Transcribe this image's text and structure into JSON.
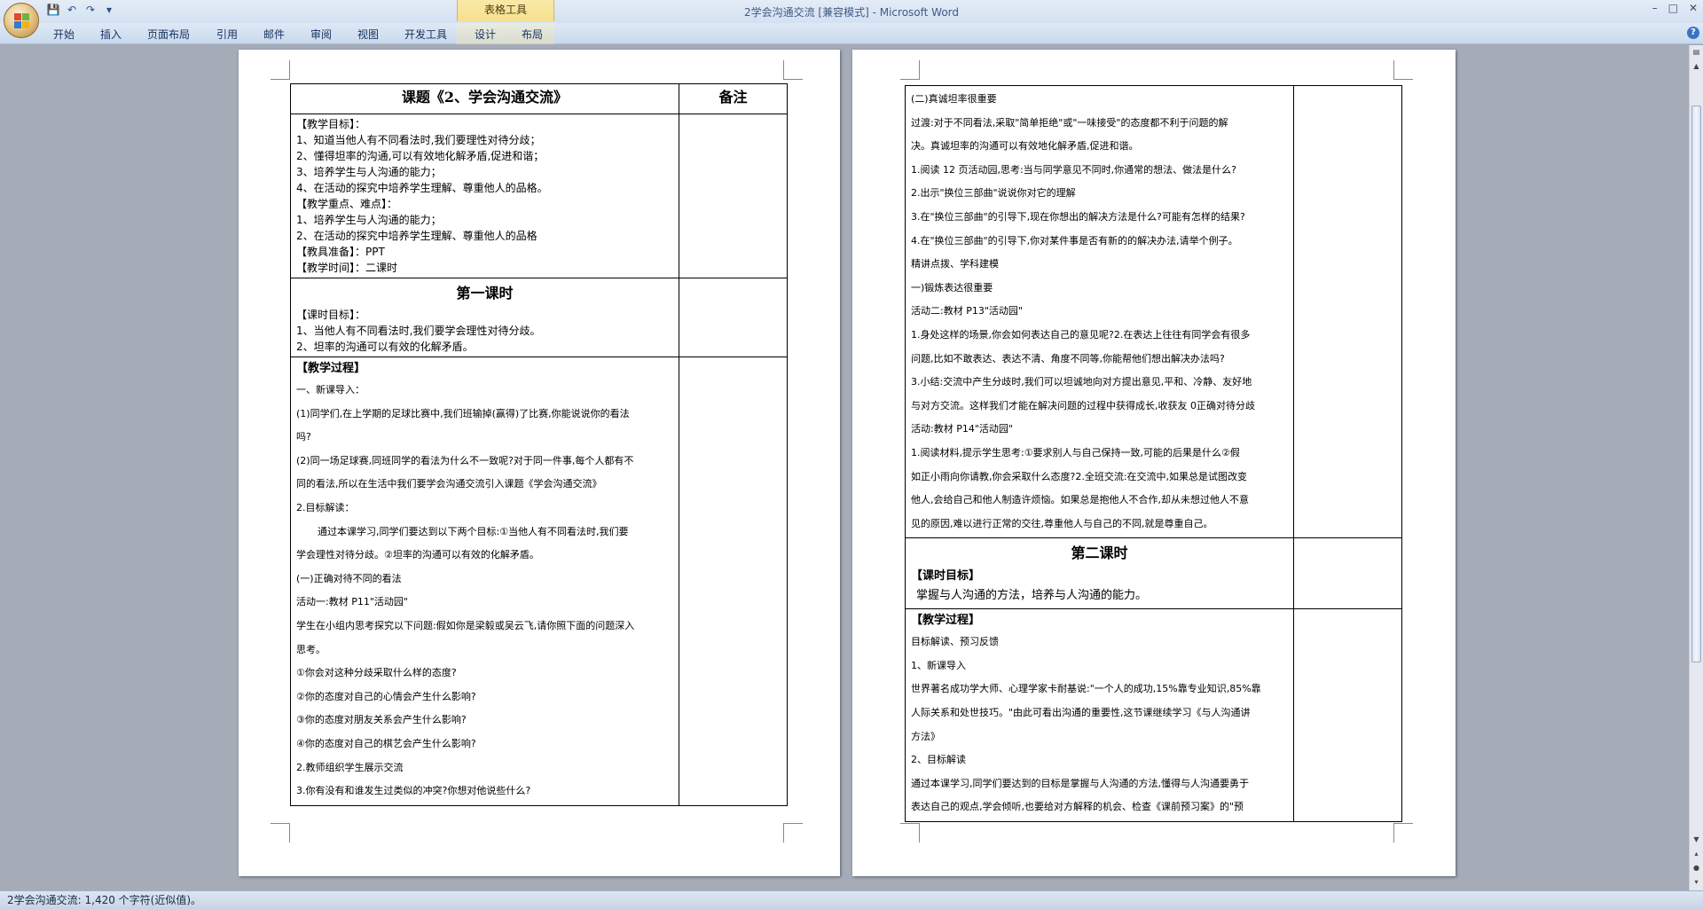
{
  "window": {
    "title": "2学会沟通交流 [兼容模式] - Microsoft Word",
    "context_tab_group": "表格工具",
    "controls": [
      "–",
      "□",
      "✕"
    ]
  },
  "quick_access": {
    "icons": [
      "save-icon",
      "undo-icon",
      "redo-icon",
      "customize-icon"
    ]
  },
  "ribbon": {
    "tabs": [
      "开始",
      "插入",
      "页面布局",
      "引用",
      "邮件",
      "审阅",
      "视图",
      "开发工具",
      "设计",
      "布局"
    ]
  },
  "statusbar": {
    "text": "2学会沟通交流: 1,420 个字符(近似值)。"
  },
  "page1": {
    "header_title": "课题《2、学会沟通交流》",
    "header_note": "备注",
    "block1": [
      "【教学目标】：",
      "1、知道当他人有不同看法时,我们要理性对待分歧；",
      "2、懂得坦率的沟通,可以有效地化解矛盾,促进和谐；",
      "3、培养学生与人沟通的能力；",
      "4、在活动的探究中培养学生理解、尊重他人的品格。",
      "【教学重点、难点】：",
      "1、培养学生与人沟通的能力；",
      "2、在活动的探究中培养学生理解、尊重他人的品格",
      "【教具准备】：PPT",
      "【教学时间】：二课时"
    ],
    "lesson1_title": "第一课时",
    "lesson1_goals": [
      "【课时目标】：",
      "1、当他人有不同看法时,我们要学会理性对待分歧。",
      "2、坦率的沟通可以有效的化解矛盾。"
    ],
    "process_title": "【教学过程】",
    "process": [
      "一、新课导入：",
      "(1)同学们,在上学期的足球比赛中,我们班输掉(赢得)了比赛,你能说说你的看法",
      "吗?",
      "(2)同一场足球赛,同班同学的看法为什么不一致呢?对于同一件事,每个人都有不",
      "同的看法,所以在生活中我们要学会沟通交流引入课题《学会沟通交流》",
      "2.目标解读：",
      "通过本课学习,同学们要达到以下两个目标:①当他人有不同看法时,我们要",
      "学会理性对待分歧。②坦率的沟通可以有效的化解矛盾。",
      "(一)正确对待不同的看法",
      "活动一:教材 P11\"活动园\"",
      "学生在小组内思考探究以下问题:假如你是梁毅或吴云飞,请你照下面的问题深入",
      "思考。",
      "①你会对这种分歧采取什么样的态度?",
      "②你的态度对自己的心情会产生什么影响?",
      "③你的态度对朋友关系会产生什么影响?",
      "④你的态度对自己的棋艺会产生什么影响?",
      "2.教师组织学生展示交流",
      "3.你有没有和谁发生过类似的冲突?你想对他说些什么?"
    ]
  },
  "page2": {
    "block1": [
      "(二)真诚坦率很重要",
      "过渡:对于不同看法,采取\"简单拒绝\"或\"一味接受\"的态度都不利于问题的解",
      "决。真诚坦率的沟通可以有效地化解矛盾,促进和谐。",
      "1.阅读 12 页活动园,思考:当与同学意见不同时,你通常的想法、做法是什么?",
      "2.出示\"换位三部曲\"说说你对它的理解",
      "3.在\"换位三部曲\"的引导下,现在你想出的解决方法是什么?可能有怎样的结果?",
      "4.在\"换位三部曲\"的引导下,你对某件事是否有新的的解决办法,请举个例子。",
      "精讲点拨、学科建模",
      "一)锻炼表达很重要",
      "活动二:教材 P13\"活动园\"",
      "1.身处这样的场景,你会如何表达自己的意见呢?2.在表达上往往有同学会有很多",
      "问题,比如不敢表达、表达不清、角度不同等,你能帮他们想出解决办法吗?",
      "3.小结:交流中产生分歧时,我们可以坦诚地向对方提出意见,平和、冷静、友好地",
      "与对方交流。这样我们才能在解决问题的过程中获得成长,收获友 0正确对待分歧",
      "活动:教材 P14\"活动园\"",
      "1.阅读材料,提示学生思考:①要求别人与自己保持一致,可能的后果是什么②假",
      "如正小雨向你请教,你会采取什么态度?2.全班交流:在交流中,如果总是试图改变",
      "他人,会给自己和他人制造许烦恼。如果总是抱他人不合作,却从未想过他人不意",
      "见的原因,难以进行正常的交往,尊重他人与自己的不同,就是尊重自己。"
    ],
    "lesson2_title": "第二课时",
    "lesson2_goals": [
      "【课时目标】",
      "掌握与人沟通的方法，培养与人沟通的能力。"
    ],
    "process_title": "【教学过程】",
    "process": [
      "目标解读、预习反馈",
      "1、新课导入",
      "世界著名成功学大师、心理学家卡耐基说:\"一个人的成功,15%靠专业知识,85%靠",
      "人际关系和处世技巧。\"由此可看出沟通的重要性,这节课继续学习《与人沟通讲",
      "方法》",
      "2、目标解读",
      "通过本课学习,同学们要达到的目标是掌握与人沟通的方法,懂得与人沟通要勇于",
      "表达自己的观点,学会倾听,也要给对方解释的机会、检查《课前预习案》的\"预"
    ]
  }
}
